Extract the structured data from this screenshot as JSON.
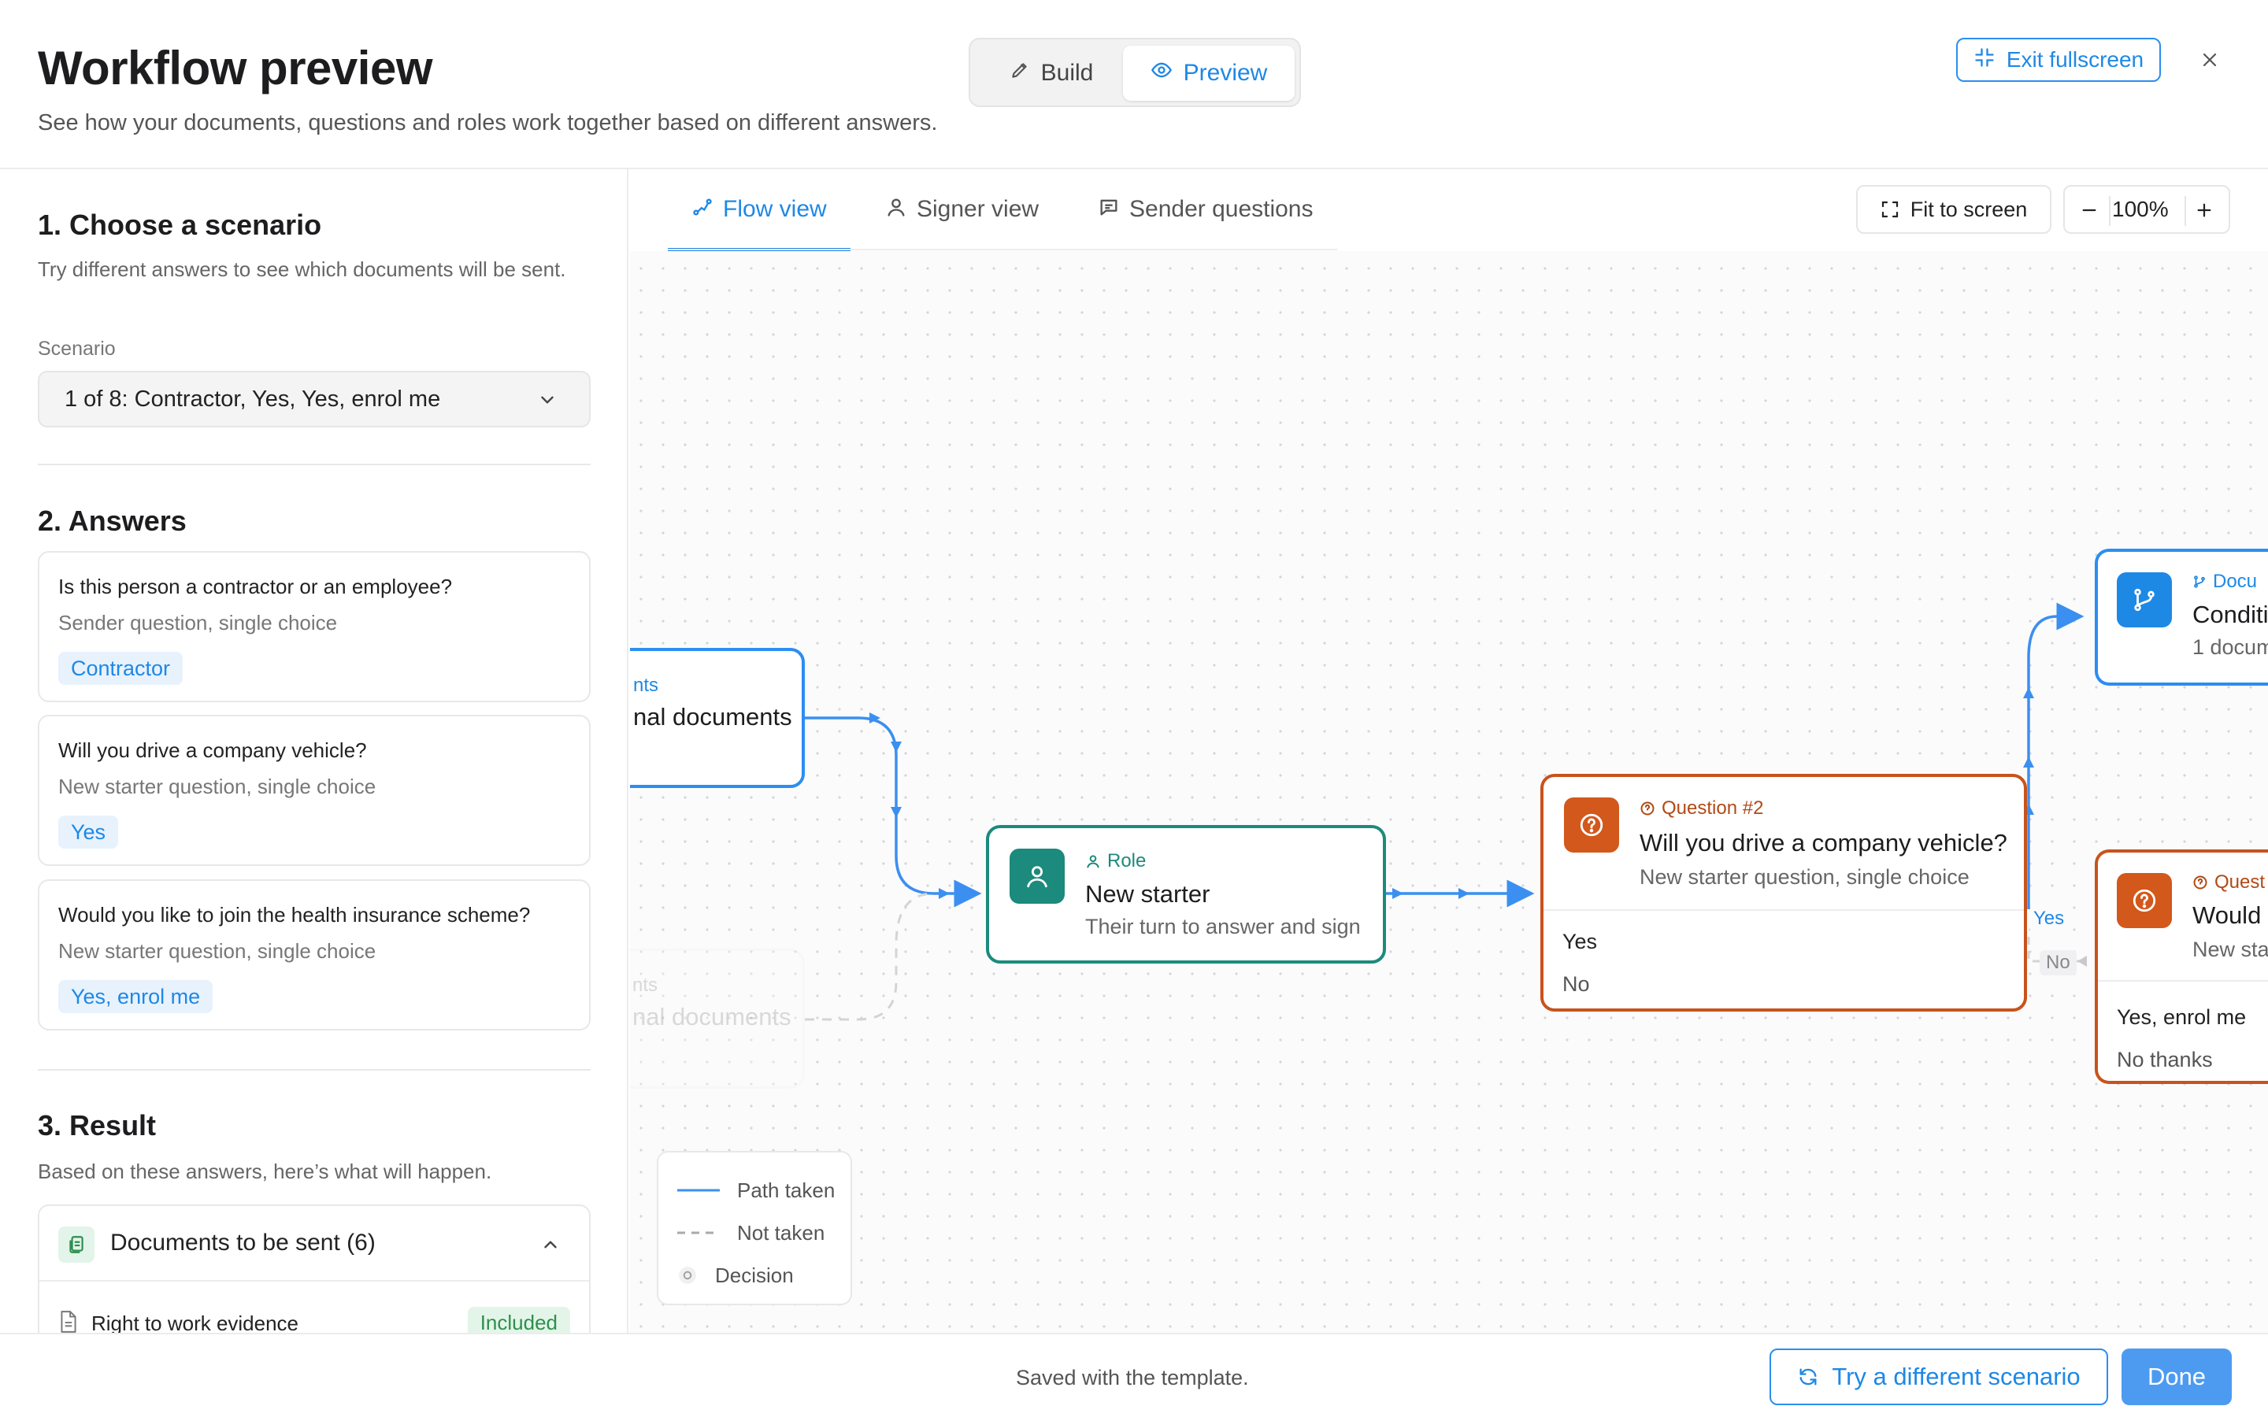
{
  "header": {
    "title": "Workflow preview",
    "subtitle": "See how your documents, questions and roles work together based on different answers.",
    "mode_build": "Build",
    "mode_preview": "Preview",
    "exit_fullscreen": "Exit fullscreen"
  },
  "left": {
    "section1_title": "1. Choose a scenario",
    "section1_desc": "Try different answers to see which documents will be sent.",
    "scenario_label": "Scenario",
    "scenario_value": "1 of 8: Contractor, Yes, Yes, enrol me",
    "section2_title": "2. Answers",
    "answers": [
      {
        "question": "Is this person a contractor or an employee?",
        "meta": "Sender question, single choice",
        "answer": "Contractor"
      },
      {
        "question": "Will you drive a company vehicle?",
        "meta": "New starter question, single choice",
        "answer": "Yes"
      },
      {
        "question": "Would you like to join the health insurance scheme?",
        "meta": "New starter question, single choice",
        "answer": "Yes, enrol me"
      }
    ],
    "section3_title": "3. Result",
    "section3_desc": "Based on these answers, here’s what will happen.",
    "docs_title": "Documents to be sent (6)",
    "doc_rows": [
      {
        "name": "Right to work evidence",
        "status": "Included"
      }
    ]
  },
  "canvas": {
    "tabs": [
      "Flow view",
      "Signer view",
      "Sender questions"
    ],
    "fit_to_screen": "Fit to screen",
    "zoom": "100%",
    "nodes": {
      "docs_left": {
        "kicker": "nts",
        "title": "nal documents"
      },
      "docs_left_faded": {
        "kicker": "nts",
        "title": "nal documents"
      },
      "role": {
        "kicker": "Role",
        "title": "New starter",
        "subtitle": "Their turn to answer and sign"
      },
      "question2": {
        "kicker": "Question #2",
        "title": "Will you drive a company vehicle?",
        "subtitle": "New starter question, single choice",
        "options": [
          "Yes",
          "No"
        ]
      },
      "conditional": {
        "kicker": "Docu",
        "title": "Conditi",
        "subtitle": "1 docum"
      },
      "question3": {
        "kicker": "Quest",
        "title": "Would",
        "subtitle": "New sta",
        "options": [
          "Yes, enrol me",
          "No thanks"
        ]
      }
    },
    "edge_labels": {
      "yes": "Yes",
      "no": "No"
    },
    "legend": {
      "path_taken": "Path taken",
      "not_taken": "Not taken",
      "decision": "Decision"
    },
    "colors": {
      "path": "#3b8ff0",
      "not_taken": "#cfcfd3",
      "role": "#1c8a7c",
      "question": "#c8531b",
      "document": "#1e88e5"
    }
  },
  "footer": {
    "saved": "Saved with the template.",
    "try_different": "Try a different scenario",
    "done": "Done"
  }
}
